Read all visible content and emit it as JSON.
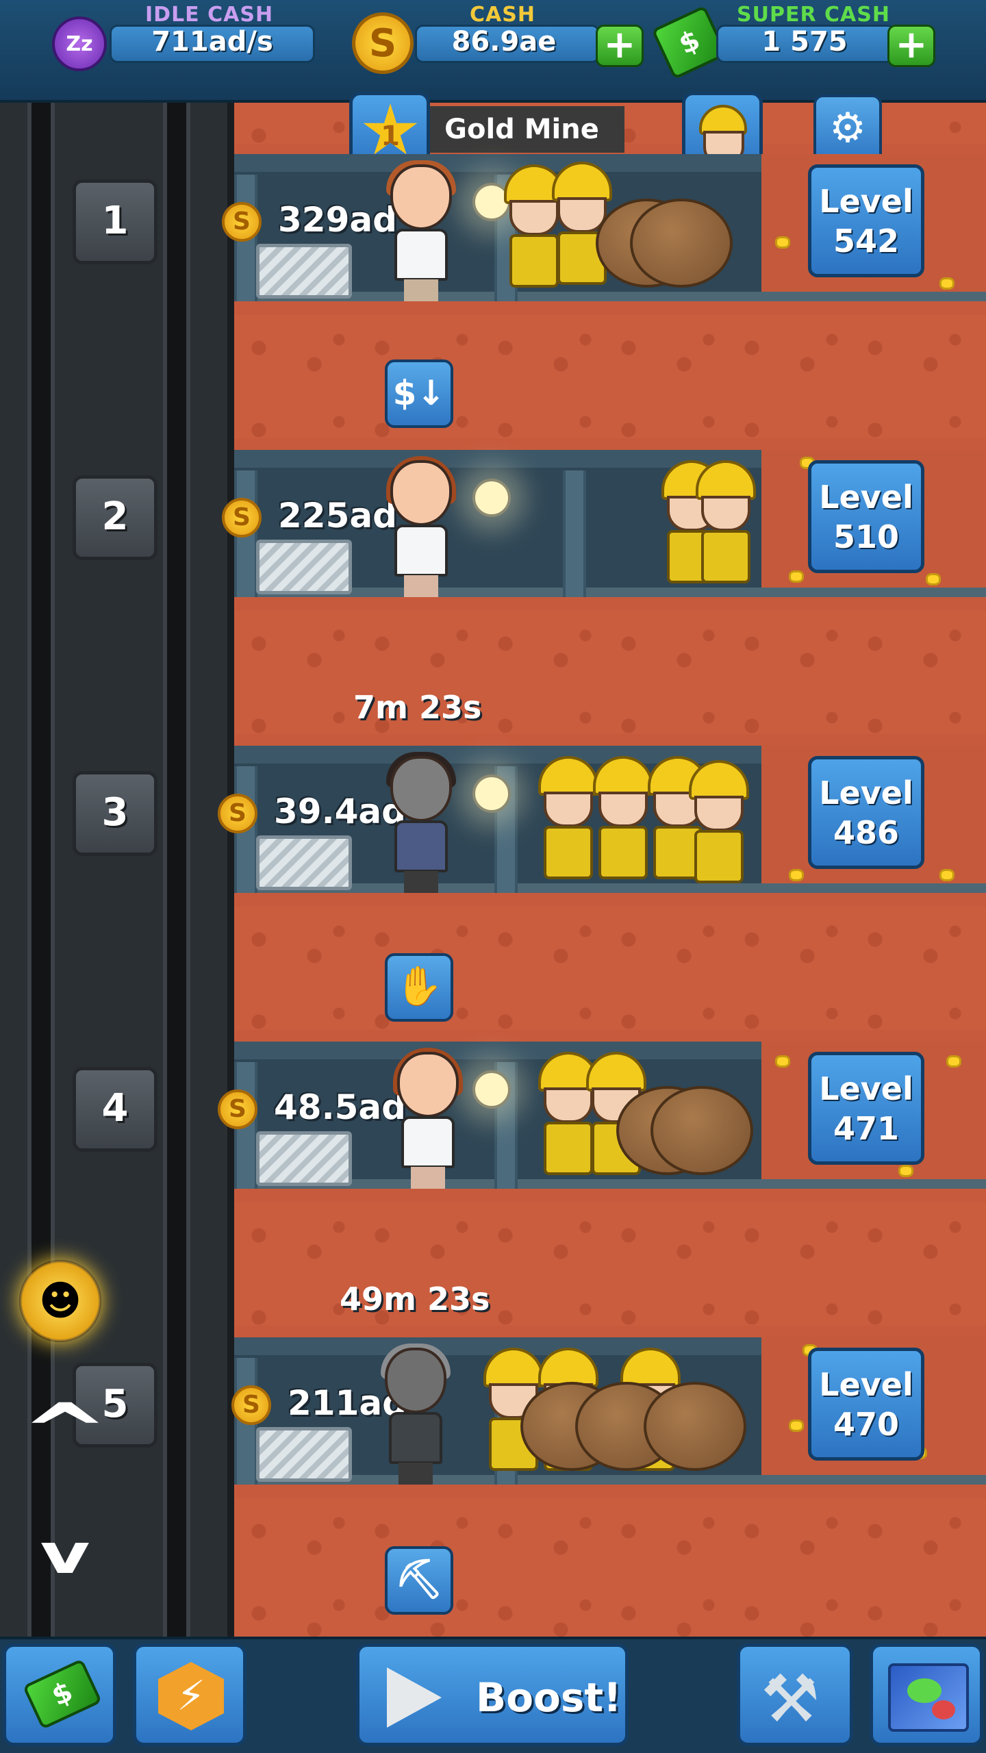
{
  "header": {
    "idle_cash": {
      "label": "IDLE CASH",
      "value": "711ad/s",
      "icon": "zzz-idle-icon"
    },
    "cash": {
      "label": "CASH",
      "value": "86.9ae",
      "icon": "gold-coin-icon"
    },
    "super_cash": {
      "label": "SUPER CASH",
      "value": "1 575",
      "icon": "super-cash-bills-icon"
    },
    "plus_glyph": "+"
  },
  "mine": {
    "title": "Gold Mine",
    "star_rank": "1"
  },
  "elevator": {
    "up_glyph": "^",
    "down_glyph": "v"
  },
  "shafts": [
    {
      "number": "1",
      "deposit": "329ad",
      "level_label": "Level",
      "level": "542"
    },
    {
      "number": "2",
      "deposit": "225ad",
      "level_label": "Level",
      "level": "510"
    },
    {
      "number": "3",
      "deposit": "39.4ad",
      "level_label": "Level",
      "level": "486",
      "timer": "7m 23s"
    },
    {
      "number": "4",
      "deposit": "48.5ad",
      "level_label": "Level",
      "level": "471"
    },
    {
      "number": "5",
      "deposit": "211ad",
      "level_label": "Level",
      "level": "470",
      "timer": "49m 23s"
    }
  ],
  "boost_icons": [
    "cost-reduction-icon",
    "speed-hand-icon",
    "pickaxe-icon"
  ],
  "footer": {
    "boost_label": "Boost!"
  },
  "colors": {
    "rock": "#c75a3c",
    "tunnel": "#2e4656",
    "button_blue": "#3a8ad6",
    "gold": "#f2cb1d",
    "green_plus": "#46b830"
  }
}
